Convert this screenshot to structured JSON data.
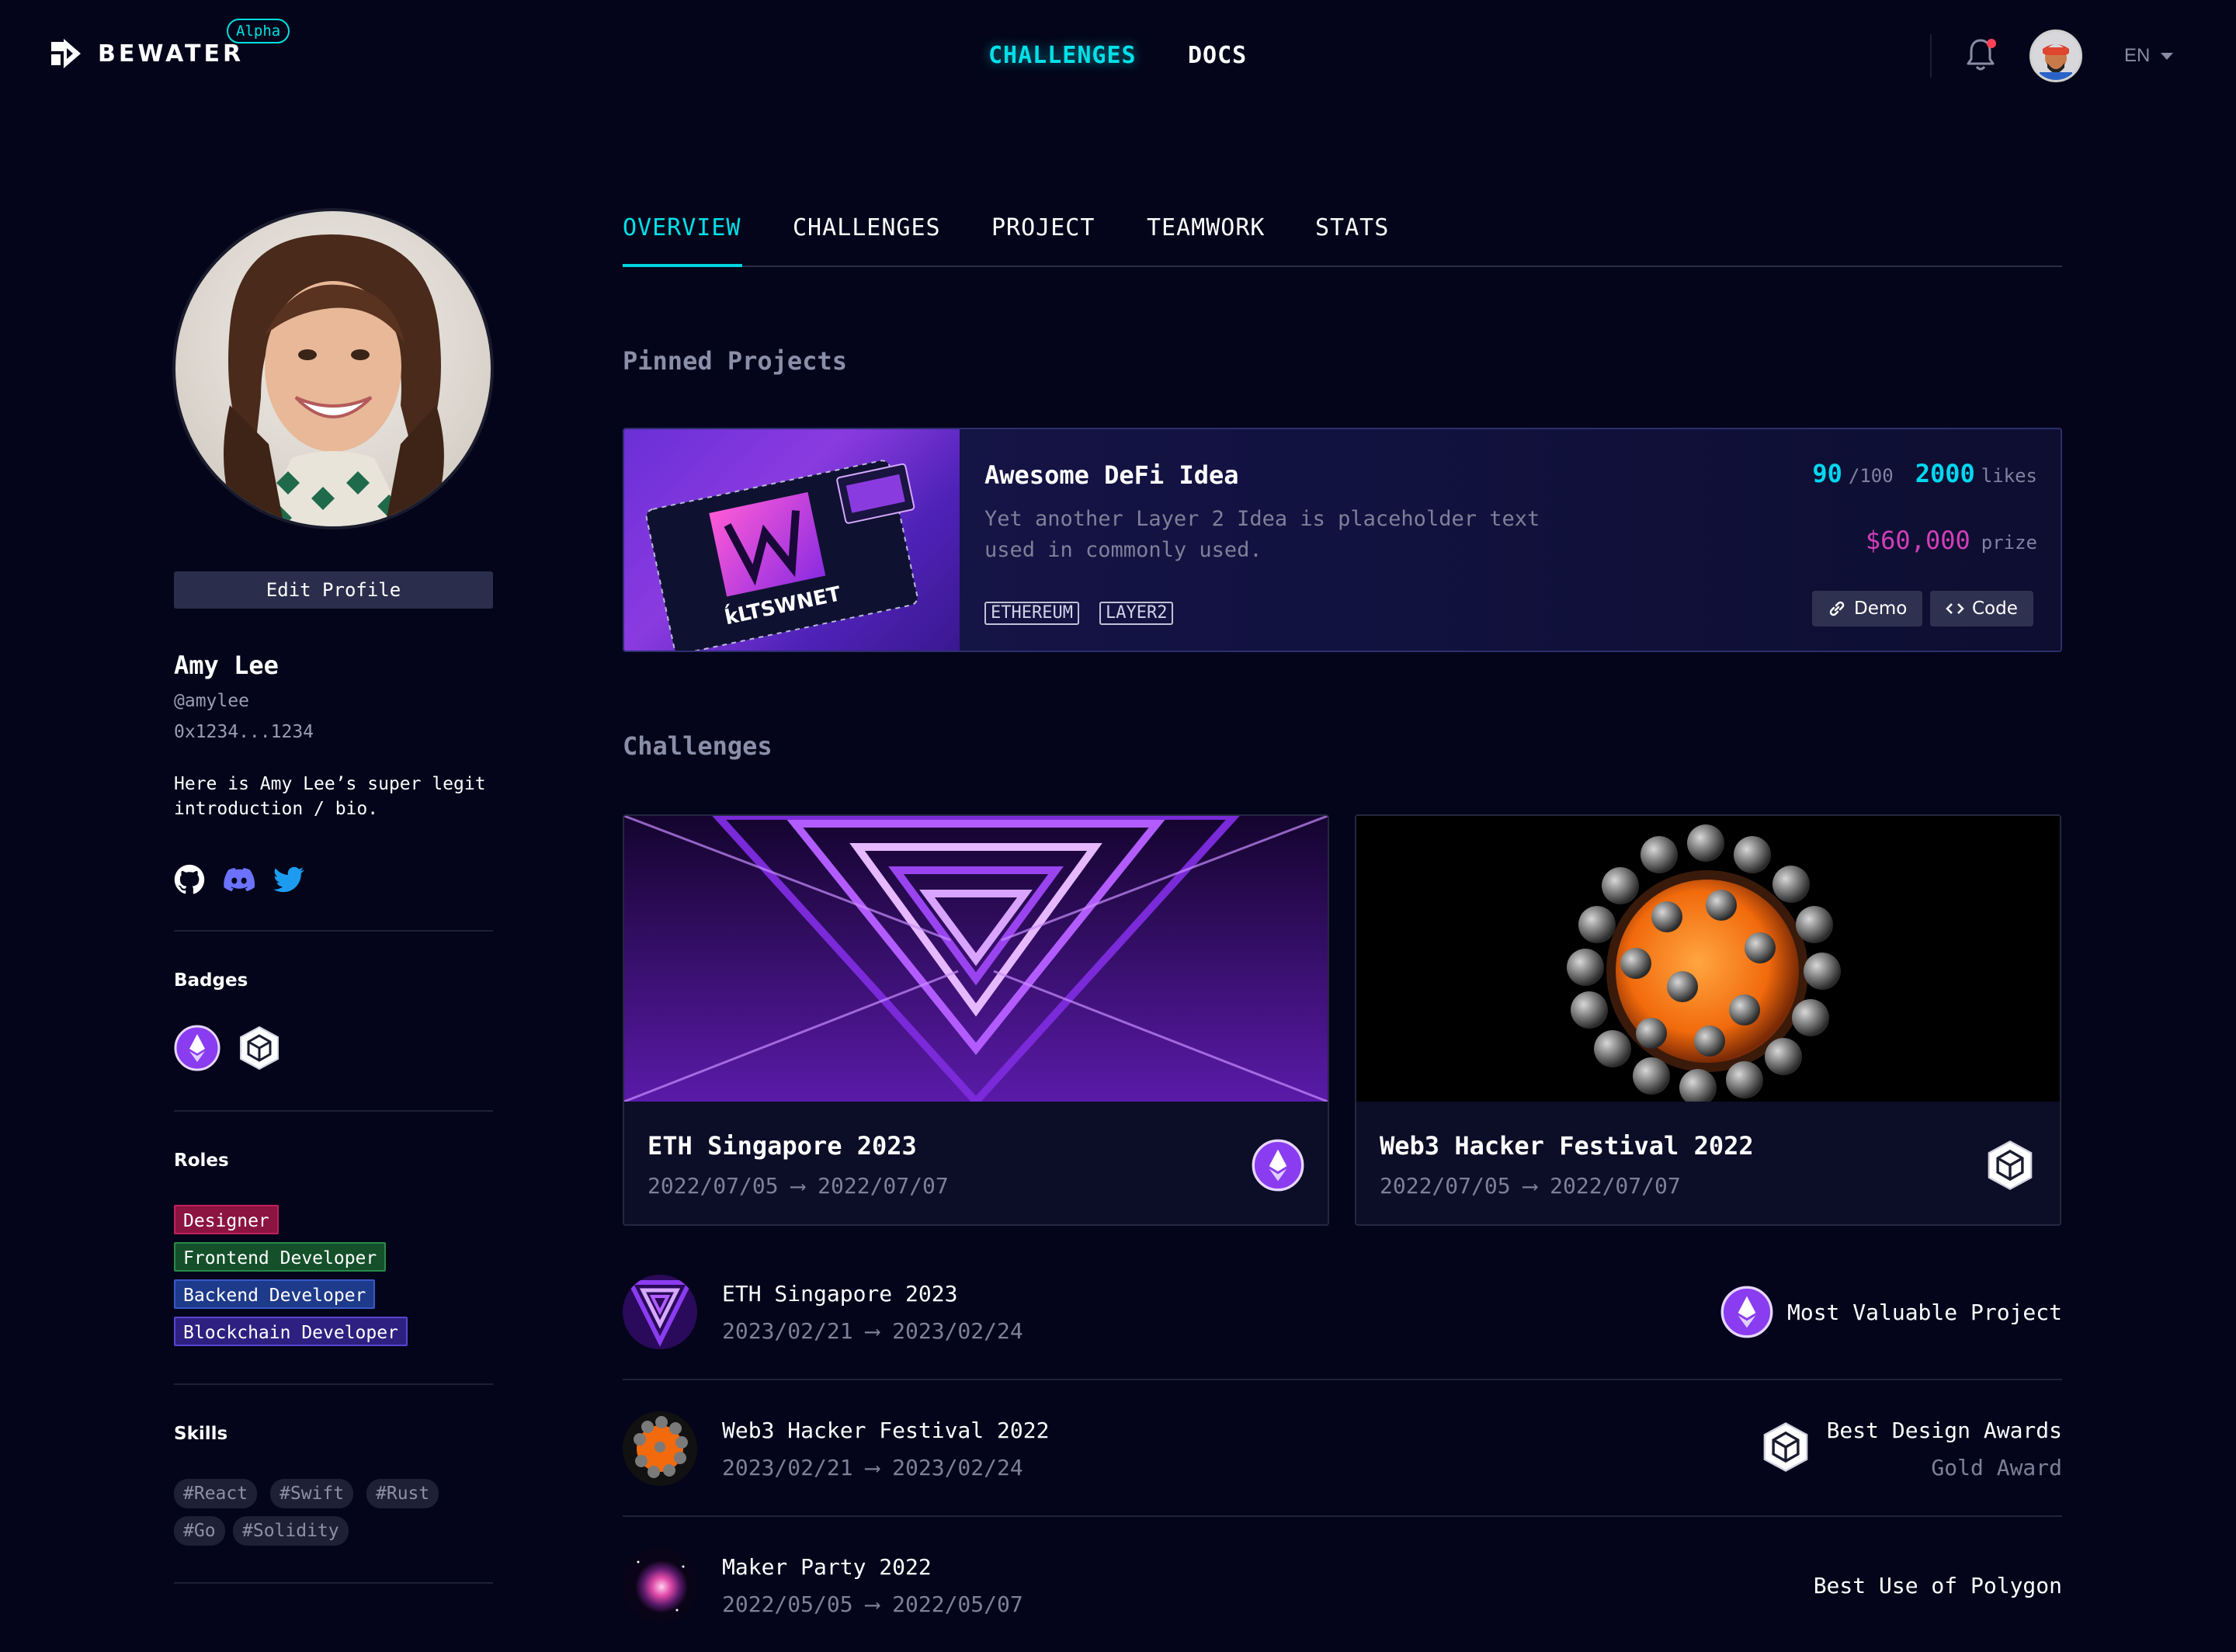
{
  "brand": {
    "name": "BEWATER",
    "tag": "Alpha"
  },
  "nav": {
    "challenges": "CHALLENGES",
    "docs": "DOCS",
    "language": "EN"
  },
  "profile": {
    "edit_label": "Edit Profile",
    "name": "Amy Lee",
    "handle": "@amylee",
    "wallet": "0x1234...1234",
    "bio": "Here is Amy Lee’s super legit introduction / bio.",
    "socials": [
      "github-icon",
      "discord-icon",
      "twitter-icon"
    ]
  },
  "sidebar": {
    "badges_label": "Badges",
    "badges": [
      "ethereum-badge",
      "cube-badge"
    ],
    "roles_label": "Roles",
    "roles": [
      "Designer",
      "Frontend Developer",
      "Backend Developer",
      "Blockchain Developer"
    ],
    "skills_label": "Skills",
    "skills": [
      "#React",
      "#Swift",
      "#Rust",
      "#Go",
      "#Solidity"
    ]
  },
  "tabs": [
    "OVERVIEW",
    "CHALLENGES",
    "PROJECT",
    "TEAMWORK",
    "STATS"
  ],
  "pinned": {
    "heading": "Pinned Projects",
    "title": "Awesome DeFi Idea",
    "description": "Yet another Layer 2 Idea is placeholder text used in commonly used.",
    "tags": [
      "ETHEREUM",
      "LAYER2"
    ],
    "score": "90",
    "score_total": "/100",
    "likes": "2000",
    "likes_label": "likes",
    "prize": "$60,000",
    "prize_label": "prize",
    "demo_label": "Demo",
    "code_label": "Code",
    "image_text": "ḱLTSWNET"
  },
  "challenges": {
    "heading": "Challenges",
    "cards": [
      {
        "title": "ETH Singapore 2023",
        "dates": "2022/07/05 ⟶ 2022/07/07"
      },
      {
        "title": "Web3 Hacker Festival 2022",
        "dates": "2022/07/05 ⟶ 2022/07/07"
      }
    ],
    "list": [
      {
        "title": "ETH Singapore 2023",
        "dates": "2023/02/21 ⟶ 2023/02/24",
        "award": "Most Valuable Project",
        "award_sub": ""
      },
      {
        "title": "Web3 Hacker Festival 2022",
        "dates": "2023/02/21 ⟶ 2023/02/24",
        "award": "Best Design Awards",
        "award_sub": "Gold Award"
      },
      {
        "title": "Maker Party 2022",
        "dates": "2022/05/05 ⟶ 2022/05/07",
        "award": "Best Use of Polygon",
        "award_sub": ""
      }
    ]
  },
  "colors": {
    "background": "#04051a",
    "accent": "#00e0e8",
    "prize": "#d23fb8"
  }
}
